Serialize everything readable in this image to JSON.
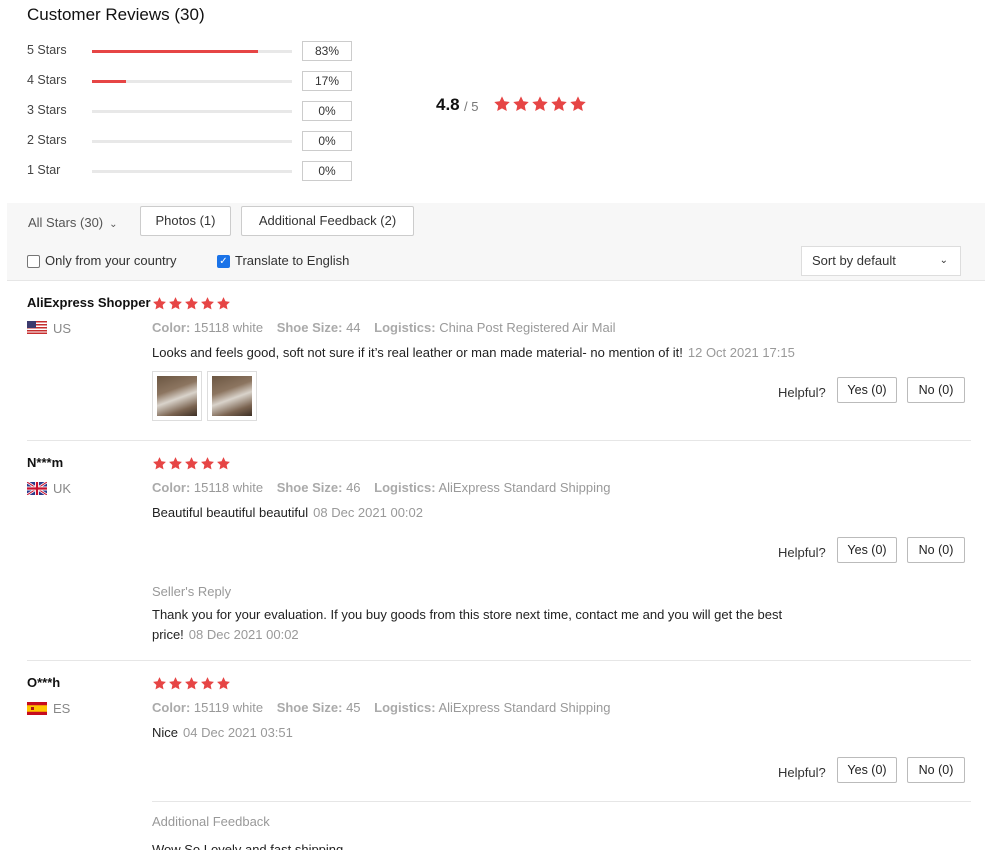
{
  "header": {
    "title": "Customer Reviews (30)"
  },
  "distribution": [
    {
      "label": "5 Stars",
      "pct": "83%",
      "fill": 0.83
    },
    {
      "label": "4 Stars",
      "pct": "17%",
      "fill": 0.17
    },
    {
      "label": "3 Stars",
      "pct": "0%",
      "fill": 0
    },
    {
      "label": "2 Stars",
      "pct": "0%",
      "fill": 0
    },
    {
      "label": "1 Star",
      "pct": "0%",
      "fill": 0
    }
  ],
  "summary": {
    "average": "4.8",
    "denominator": "/ 5",
    "stars": 5
  },
  "filters": {
    "all_stars": "All Stars (30)",
    "photos": "Photos (1)",
    "additional_feedback": "Additional Feedback (2)",
    "only_country": "Only from your country",
    "only_country_checked": false,
    "translate": "Translate to English",
    "translate_checked": true,
    "sort": "Sort by default"
  },
  "labels": {
    "color": "Color:",
    "shoe_size": "Shoe Size:",
    "logistics": "Logistics:",
    "helpful": "Helpful?",
    "sellers_reply": "Seller's Reply",
    "additional_feedback": "Additional Feedback"
  },
  "colors": {
    "star": "#e64545",
    "accent_check": "#1a73e8"
  },
  "reviews": [
    {
      "name": "AliExpress Shopper",
      "country": "US",
      "flag": "us-flag-icon",
      "stars": 5,
      "color": "15118 white",
      "shoe_size": "44",
      "logistics": "China Post Registered Air Mail",
      "text": "Looks and feels good, soft not sure if it’s real leather or man made material- no mention of it!",
      "date": "12 Oct 2021 17:15",
      "yes": "Yes (0)",
      "no": "No (0)",
      "photos": 2
    },
    {
      "name": "N***m",
      "country": "UK",
      "flag": "uk-flag-icon",
      "stars": 5,
      "color": "15118 white",
      "shoe_size": "46",
      "logistics": "AliExpress Standard Shipping",
      "text": "Beautiful beautiful beautiful",
      "date": "08 Dec 2021 00:02",
      "yes": "Yes (0)",
      "no": "No (0)",
      "reply_line1": "Thank you for your evaluation. If you buy goods from this store next time, contact me and you will get the best",
      "reply_line2": "price!",
      "reply_date": "08 Dec 2021 00:02"
    },
    {
      "name": "O***h",
      "country": "ES",
      "flag": "spain-flag-icon",
      "stars": 5,
      "color": "15119 white",
      "shoe_size": "45",
      "logistics": "AliExpress Standard Shipping",
      "text": "Nice",
      "date": "04 Dec 2021 03:51",
      "yes": "Yes (0)",
      "no": "No (0)",
      "additional_text": "Wow So Lovely and fast shipping"
    }
  ]
}
